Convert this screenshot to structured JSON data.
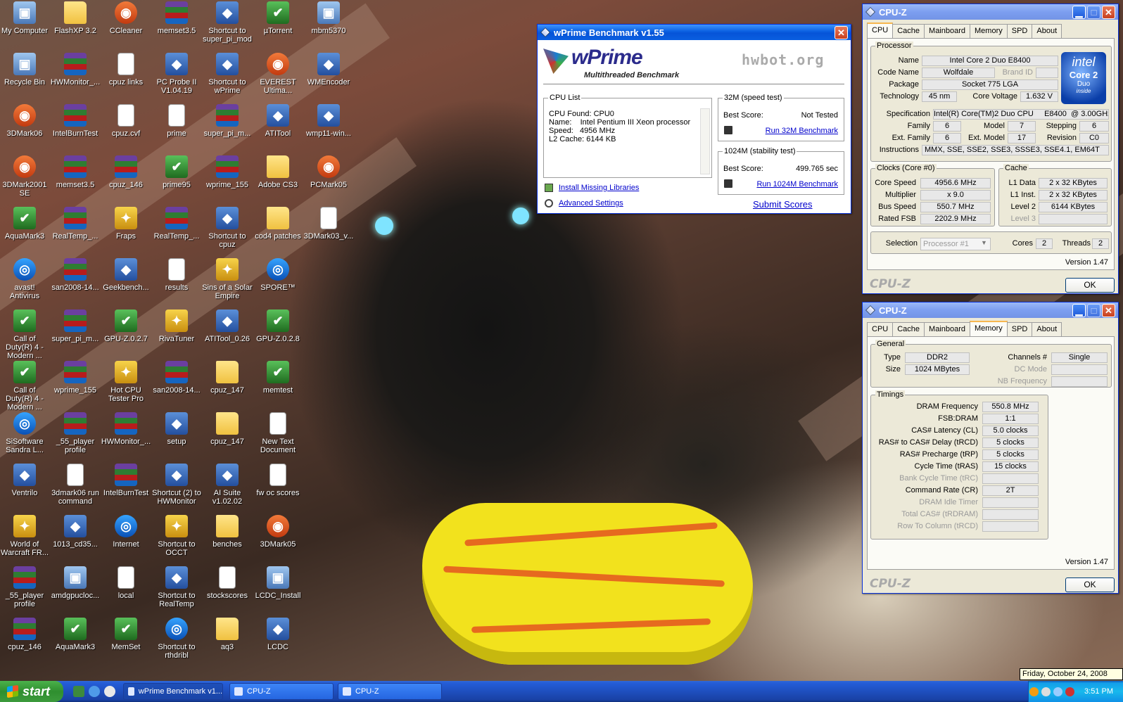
{
  "desktop_icons": [
    [
      "My Computer",
      "FlashXP 3.2",
      "CCleaner",
      "memset3.5",
      "Shortcut to super_pi_mod",
      "µTorrent",
      "mbm5370"
    ],
    [
      "Recycle Bin",
      "HWMonitor_...",
      "cpuz links",
      "PC Probe II V1.04.19",
      "Shortcut to wPrime",
      "EVEREST Ultima...",
      "WMEncoder"
    ],
    [
      "3DMark06",
      "IntelBurnTest",
      "cpuz.cvf",
      "prime",
      "super_pi_m...",
      "ATITool",
      "wmp11-win..."
    ],
    [
      "3DMark2001 SE",
      "memset3.5",
      "cpuz_146",
      "prime95",
      "wprime_155",
      "Adobe CS3",
      "PCMark05"
    ],
    [
      "AquaMark3",
      "RealTemp_...",
      "Fraps",
      "RealTemp_...",
      "Shortcut to cpuz",
      "cod4 patches",
      "3DMark03_v..."
    ],
    [
      "avast! Antivirus",
      "san2008-14...",
      "Geekbench...",
      "results",
      "Sins of a Solar Empire",
      "SPORE™",
      ""
    ],
    [
      "Call of Duty(R) 4 - Modern ...",
      "super_pi_m...",
      "GPU-Z.0.2.7",
      "RivaTuner",
      "ATITool_0.26",
      "GPU-Z.0.2.8",
      ""
    ],
    [
      "Call of Duty(R) 4 - Modern ...",
      "wprime_155",
      "Hot CPU Tester Pro",
      "san2008-14...",
      "cpuz_147",
      "memtest",
      ""
    ],
    [
      "SiSoftware Sandra L...",
      "_55_player profile",
      "HWMonitor_...",
      "setup",
      "cpuz_147",
      "New Text Document",
      ""
    ],
    [
      "Ventrilo",
      "3dmark06 run command",
      "IntelBurnTest",
      "Shortcut (2) to HWMonitor",
      "AI Suite v1.02.02",
      "fw oc scores",
      ""
    ],
    [
      "World of Warcraft FR...",
      "1013_cd35...",
      "Internet",
      "Shortcut to OCCT",
      "benches",
      "3DMark05",
      ""
    ],
    [
      "_55_player profile",
      "amdgpucloc...",
      "local",
      "Shortcut to RealTemp",
      "stockscores",
      "LCDC_Install",
      ""
    ],
    [
      "cpuz_146",
      "AquaMark3",
      "MemSet",
      "Shortcut to rthdribl",
      "aq3",
      "LCDC",
      ""
    ]
  ],
  "wprime": {
    "title": "wPrime Benchmark v1.55",
    "logo": "wPrime",
    "logo_sub": "Multithreaded Benchmark",
    "hwbot": "hwbot.org",
    "cpu_list_label": "CPU List",
    "cpu_lines": [
      "CPU Found: CPU0",
      "Name:    Intel Pentium III Xeon processor",
      "Speed:   4956 MHz",
      "L2 Cache: 6144 KB"
    ],
    "speed_label": "32M (speed test)",
    "speed_best_label": "Best Score:",
    "speed_best": "Not Tested",
    "speed_run": "Run 32M Benchmark",
    "stab_label": "1024M (stability test)",
    "stab_best_label": "Best Score:",
    "stab_best": "499.765 sec",
    "stab_run": "Run 1024M Benchmark",
    "install_libs": "Install Missing Libraries",
    "advanced": "Advanced Settings",
    "submit": "Submit Scores"
  },
  "cpuz1": {
    "title": "CPU-Z",
    "tabs": [
      "CPU",
      "Cache",
      "Mainboard",
      "Memory",
      "SPD",
      "About"
    ],
    "processor_label": "Processor",
    "name_l": "Name",
    "name": "Intel Core 2 Duo E8400",
    "code_l": "Code Name",
    "code": "Wolfdale",
    "brand_l": "Brand ID",
    "package_l": "Package",
    "package": "Socket 775 LGA",
    "tech_l": "Technology",
    "tech": "45 nm",
    "cv_l": "Core Voltage",
    "cv": "1.632 V",
    "spec_l": "Specification",
    "spec": "Intel(R) Core(TM)2 Duo CPU     E8400  @ 3.00GHz",
    "family_l": "Family",
    "family": "6",
    "model_l": "Model",
    "model": "7",
    "stepping_l": "Stepping",
    "stepping": "6",
    "extfam_l": "Ext. Family",
    "extfam": "6",
    "extmod_l": "Ext. Model",
    "extmod": "17",
    "rev_l": "Revision",
    "rev": "C0",
    "instr_l": "Instructions",
    "instr": "MMX, SSE, SSE2, SSE3, SSSE3, SSE4.1, EM64T",
    "clocks_label": "Clocks (Core #0)",
    "cs_l": "Core Speed",
    "cs": "4956.6 MHz",
    "mul_l": "Multiplier",
    "mul": "x 9.0",
    "bus_l": "Bus Speed",
    "bus": "550.7 MHz",
    "fsb_l": "Rated FSB",
    "fsb": "2202.9 MHz",
    "cache_label": "Cache",
    "l1d_l": "L1 Data",
    "l1d": "2 x 32 KBytes",
    "l1i_l": "L1 Inst.",
    "l1i": "2 x 32 KBytes",
    "l2_l": "Level 2",
    "l2": "6144 KBytes",
    "l3_l": "Level 3",
    "sel_l": "Selection",
    "sel": "Processor #1",
    "cores_l": "Cores",
    "cores": "2",
    "threads_l": "Threads",
    "threads": "2",
    "version": "Version 1.47",
    "brand": "CPU-Z",
    "ok": "OK",
    "intel_logo": "intel",
    "intel_core": "Core 2",
    "intel_duo": "Duo",
    "intel_inside": "inside"
  },
  "cpuz2": {
    "title": "CPU-Z",
    "tabs": [
      "CPU",
      "Cache",
      "Mainboard",
      "Memory",
      "SPD",
      "About"
    ],
    "general_label": "General",
    "type_l": "Type",
    "type": "DDR2",
    "size_l": "Size",
    "size": "1024 MBytes",
    "chan_l": "Channels #",
    "chan": "Single",
    "dc_l": "DC Mode",
    "nb_l": "NB Frequency",
    "timings_label": "Timings",
    "timings": [
      [
        "DRAM Frequency",
        "550.8 MHz",
        true
      ],
      [
        "FSB:DRAM",
        "1:1",
        true
      ],
      [
        "CAS# Latency (CL)",
        "5.0 clocks",
        true
      ],
      [
        "RAS# to CAS# Delay (tRCD)",
        "5 clocks",
        true
      ],
      [
        "RAS# Precharge (tRP)",
        "5 clocks",
        true
      ],
      [
        "Cycle Time (tRAS)",
        "15 clocks",
        true
      ],
      [
        "Bank Cycle Time (tRC)",
        "",
        false
      ],
      [
        "Command Rate (CR)",
        "2T",
        true
      ],
      [
        "DRAM Idle Timer",
        "",
        false
      ],
      [
        "Total CAS# (tRDRAM)",
        "",
        false
      ],
      [
        "Row To Column (tRCD)",
        "",
        false
      ]
    ],
    "version": "Version 1.47",
    "brand": "CPU-Z",
    "ok": "OK"
  },
  "taskbar": {
    "start": "start",
    "tasks": [
      "wPrime Benchmark v1...",
      "CPU-Z",
      "CPU-Z"
    ],
    "clock": "3:51 PM",
    "date_tooltip": "Friday, October 24, 2008"
  }
}
